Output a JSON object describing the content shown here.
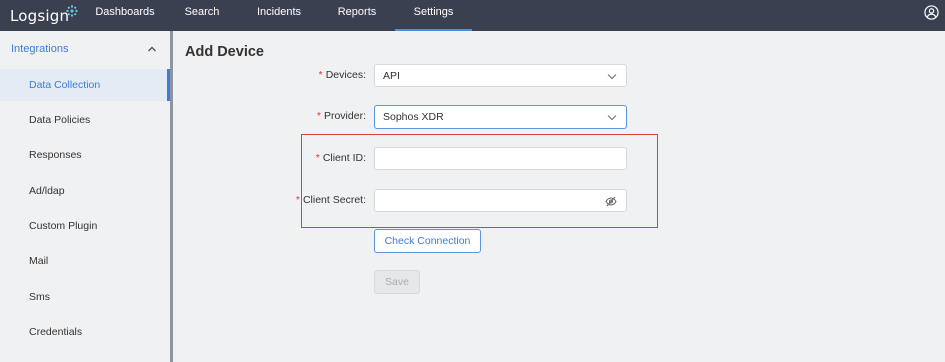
{
  "app": {
    "logo_text": "Logsign",
    "colors": {
      "topbar": "#3a4050",
      "accent": "#3b7dd8",
      "required": "#e0342a",
      "highlight": "#d9413d"
    }
  },
  "nav": {
    "items": [
      {
        "label": "Dashboards"
      },
      {
        "label": "Search"
      },
      {
        "label": "Incidents"
      },
      {
        "label": "Reports"
      },
      {
        "label": "Settings",
        "active": true
      }
    ],
    "user_icon": "user-circle-icon"
  },
  "sidebar": {
    "section_label": "Integrations",
    "section_icon": "chevron-up-icon",
    "items": [
      {
        "label": "Data Collection",
        "active": true
      },
      {
        "label": "Data Policies"
      },
      {
        "label": "Responses"
      },
      {
        "label": "Ad/ldap"
      },
      {
        "label": "Custom Plugin"
      },
      {
        "label": "Mail"
      },
      {
        "label": "Sms"
      },
      {
        "label": "Credentials"
      }
    ]
  },
  "main": {
    "title": "Add Device",
    "form": {
      "required_mark": "*",
      "devices": {
        "label": "Devices",
        "value": "API"
      },
      "provider": {
        "label": "Provider",
        "value": "Sophos XDR"
      },
      "client_id": {
        "label": "Client ID",
        "value": ""
      },
      "client_secret": {
        "label": "Client Secret",
        "value": "",
        "icon": "eye-slash-icon"
      },
      "check_button": "Check Connection",
      "save_button": "Save"
    }
  }
}
